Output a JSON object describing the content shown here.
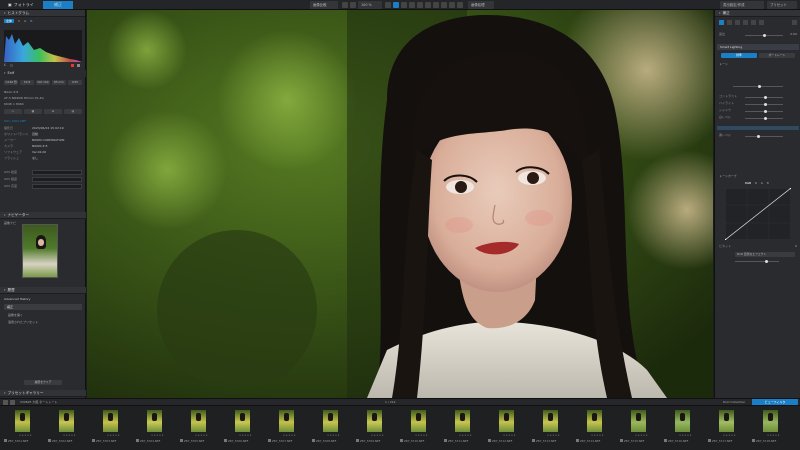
{
  "topbar": {
    "tab_library": "フォトライブラリ",
    "tab_edit": "補正",
    "btn_compare": "画像比較",
    "zoom": "100 %",
    "btn_batch": "画像処理",
    "btn_export_settings": "書出設定/作成",
    "btn_export": "書き出し",
    "btn_presets": "プリセット"
  },
  "left": {
    "histogram_title": "ヒストグラム",
    "histogram_tabs": [
      "全体",
      "R",
      "G",
      "B"
    ],
    "exif_title": "Exif",
    "exif_buttons": [
      "1/160 秒",
      "f/2.8",
      "ISO 100",
      "85 mm",
      "0 EV"
    ],
    "camera": "Nikon Z 8",
    "lens": "AF-S NIKKOR 85mm f/1.4G",
    "file": "DSC_0001.NEF",
    "size": "6048 × 8064",
    "date_label": "撮影日",
    "date_value": "2023/06/24 15:02:19",
    "make_label": "メーカー",
    "make_value": "NIKON CORPORATION",
    "model_label": "カメラ",
    "model_value": "NIKON Z 8",
    "software_label": "ソフトウェア",
    "software_value": "Ver.02.00",
    "flash_label": "フラッシュ",
    "flash_value": "なし",
    "wb_label": "ホワイトバランス",
    "wb_value": "自動",
    "gps_label": "GPS",
    "gps_fields": [
      "GPS 緯度",
      "GPS 経度",
      "GPS 高度"
    ],
    "navigator_title": "ナビゲーター",
    "nav_label": "画像ナビ",
    "history_title": "履歴",
    "history_group": "Advanced History",
    "history_items": [
      "補正",
      "画像を開く",
      "適用されたプリセット"
    ],
    "history_btn": "履歴をクリア",
    "preset_title": "プリセットギャラリー"
  },
  "right": {
    "panel_title": "補正",
    "mode_btns": [
      "標準",
      "ポートレート"
    ],
    "section_tone": "トーン",
    "exposure_label": "露出",
    "exposure_value": "0.00",
    "contrast_label": "コントラスト",
    "highlights_label": "ハイライト",
    "shadows_label": "シャドウ",
    "whites_label": "白レベル",
    "blacks_label": "黒レベル",
    "section_smart": "Smart Lighting",
    "section_curve": "トーンカーブ",
    "curve_tabs": [
      "RGB",
      "R",
      "G",
      "B"
    ],
    "section_vignette": "ビネット",
    "vignette_value": "0",
    "mode_select": "DxO 自然なエフェクト"
  },
  "filmbar": {
    "path": "230625 大阪 ポートレート",
    "count": "1 / 214",
    "btn_collection": "DxO Collection",
    "btn_filter": "ビューフィルタ"
  },
  "filmstrip": {
    "thumbs": [
      {
        "name": "Z87_5701.NEF",
        "color": "#c2c04a"
      },
      {
        "name": "Z87_5702.NEF",
        "color": "#c9c652"
      },
      {
        "name": "Z87_5703.NEF",
        "color": "#c6c34a"
      },
      {
        "name": "Z87_5704.NEF",
        "color": "#caca55"
      },
      {
        "name": "Z87_5705.NEF",
        "color": "#c4c44c"
      },
      {
        "name": "Z87_5706.NEF",
        "color": "#cac852"
      },
      {
        "name": "Z87_5707.NEF",
        "color": "#c3c14a"
      },
      {
        "name": "Z87_5708.NEF",
        "color": "#c7c54e"
      },
      {
        "name": "Z87_5709.NEF",
        "color": "#cbc956"
      },
      {
        "name": "Z87_5710.NEF",
        "color": "#c5c24b"
      },
      {
        "name": "Z87_5711.NEF",
        "color": "#c8c650"
      },
      {
        "name": "Z87_5712.NEF",
        "color": "#c3c24c"
      },
      {
        "name": "Z87_5713.NEF",
        "color": "#c9c753"
      },
      {
        "name": "Z87_5714.NEF",
        "color": "#c6c44e"
      },
      {
        "name": "Z87_5715.NEF",
        "color": "#9bb85a"
      },
      {
        "name": "Z87_5716.NEF",
        "color": "#95b862"
      },
      {
        "name": "Z87_5717.NEF",
        "color": "#a2bd63"
      },
      {
        "name": "Z87_5718.NEF",
        "color": "#98b65e"
      }
    ],
    "stars": "★★★★★"
  },
  "colors": {
    "accent": "#1a7fc6",
    "panel": "#2a2b2e",
    "viewer_bg": "#233014"
  }
}
